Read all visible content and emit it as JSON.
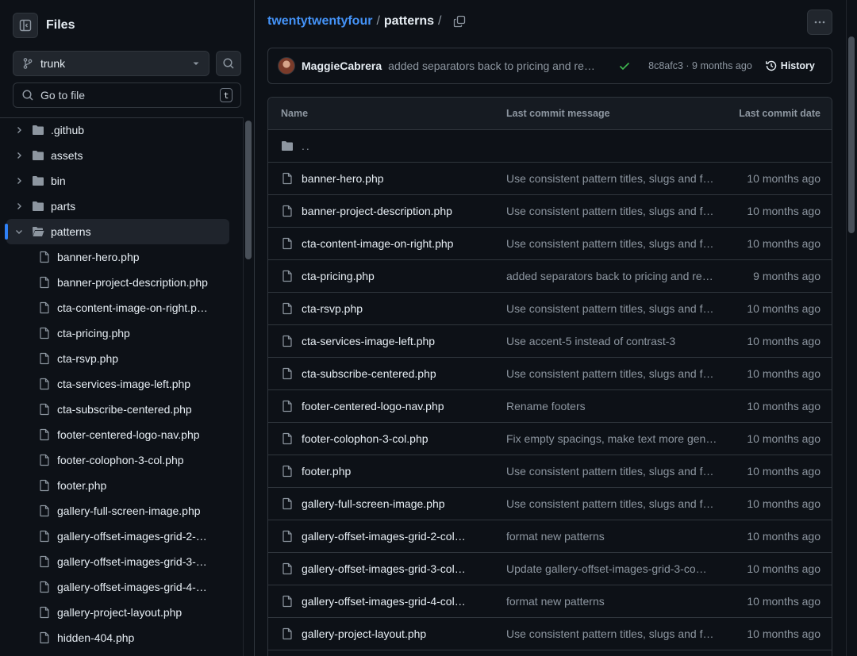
{
  "sidebar": {
    "title": "Files",
    "branch": "trunk",
    "go_to_file_placeholder": "Go to file",
    "shortcut_key": "t",
    "folders": [
      ".github",
      "assets",
      "bin",
      "parts"
    ],
    "open_folder": "patterns",
    "files": [
      "banner-hero.php",
      "banner-project-description.php",
      "cta-content-image-on-right.p…",
      "cta-pricing.php",
      "cta-rsvp.php",
      "cta-services-image-left.php",
      "cta-subscribe-centered.php",
      "footer-centered-logo-nav.php",
      "footer-colophon-3-col.php",
      "footer.php",
      "gallery-full-screen-image.php",
      "gallery-offset-images-grid-2-…",
      "gallery-offset-images-grid-3-…",
      "gallery-offset-images-grid-4-…",
      "gallery-project-layout.php",
      "hidden-404.php"
    ]
  },
  "breadcrumb": {
    "repo": "twentytwentyfour",
    "separator": "/",
    "current": "patterns",
    "trailing": "/"
  },
  "latest_commit": {
    "author": "MaggieCabrera",
    "message": "added separators back to pricing and re…",
    "sha_time": "8c8afc3 · 9 months ago",
    "history_label": "History"
  },
  "table": {
    "headers": {
      "name": "Name",
      "message": "Last commit message",
      "date": "Last commit date"
    },
    "parent": "..",
    "rows": [
      {
        "name": "banner-hero.php",
        "message": "Use consistent pattern titles, slugs and f…",
        "date": "10 months ago"
      },
      {
        "name": "banner-project-description.php",
        "message": "Use consistent pattern titles, slugs and f…",
        "date": "10 months ago"
      },
      {
        "name": "cta-content-image-on-right.php",
        "message": "Use consistent pattern titles, slugs and f…",
        "date": "10 months ago"
      },
      {
        "name": "cta-pricing.php",
        "message": "added separators back to pricing and re…",
        "date": "9 months ago"
      },
      {
        "name": "cta-rsvp.php",
        "message": "Use consistent pattern titles, slugs and f…",
        "date": "10 months ago"
      },
      {
        "name": "cta-services-image-left.php",
        "message": "Use accent-5 instead of contrast-3",
        "date": "10 months ago"
      },
      {
        "name": "cta-subscribe-centered.php",
        "message": "Use consistent pattern titles, slugs and f…",
        "date": "10 months ago"
      },
      {
        "name": "footer-centered-logo-nav.php",
        "message": "Rename footers",
        "date": "10 months ago"
      },
      {
        "name": "footer-colophon-3-col.php",
        "message": "Fix empty spacings, make text more gen…",
        "date": "10 months ago"
      },
      {
        "name": "footer.php",
        "message": "Use consistent pattern titles, slugs and f…",
        "date": "10 months ago"
      },
      {
        "name": "gallery-full-screen-image.php",
        "message": "Use consistent pattern titles, slugs and f…",
        "date": "10 months ago"
      },
      {
        "name": "gallery-offset-images-grid-2-col…",
        "message": "format new patterns",
        "date": "10 months ago"
      },
      {
        "name": "gallery-offset-images-grid-3-col…",
        "message": "Update gallery-offset-images-grid-3-co…",
        "date": "10 months ago"
      },
      {
        "name": "gallery-offset-images-grid-4-col…",
        "message": "format new patterns",
        "date": "10 months ago"
      },
      {
        "name": "gallery-project-layout.php",
        "message": "Use consistent pattern titles, slugs and f…",
        "date": "10 months ago"
      }
    ]
  },
  "colors": {
    "background": "#0d1117",
    "border": "#30363d",
    "link": "#4493f8",
    "muted": "#8d96a0",
    "success": "#3fb950",
    "accent": "#2f81f7"
  }
}
